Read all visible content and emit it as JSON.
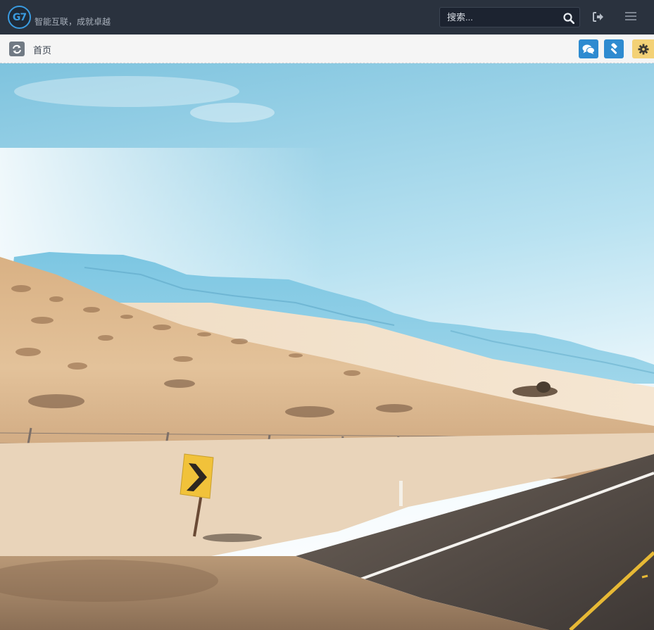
{
  "app": {
    "logo_text": "G7",
    "slogan": "智能互联，成就卓越"
  },
  "search": {
    "placeholder": "搜索..."
  },
  "breadcrumb": {
    "home": "首页"
  },
  "icons": {
    "logo": "g7-logo",
    "search": "search-icon",
    "logout": "sign-out-icon",
    "menu": "bars-icon",
    "refresh": "refresh-icon",
    "chat": "comments-icon",
    "tool": "gavel-icon",
    "settings": "gear-icon",
    "road_sign": "chevron-right-sign"
  },
  "colors": {
    "navbar": "#2a323e",
    "accent_blue": "#2e8bd0",
    "settings_yellow": "#f3d176",
    "subbar": "#f5f5f5"
  }
}
